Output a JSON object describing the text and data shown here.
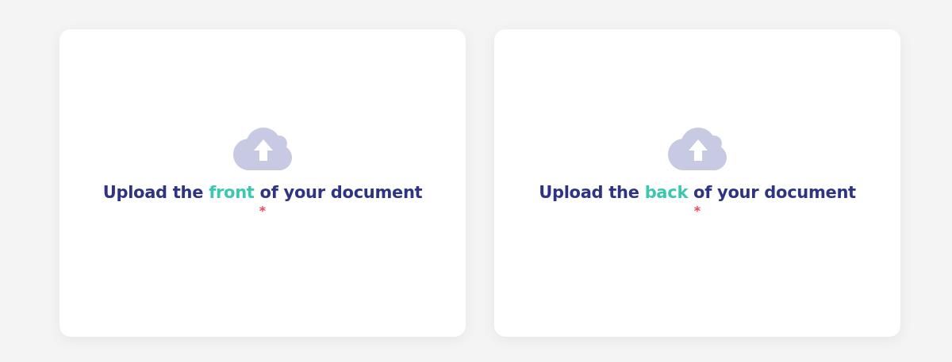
{
  "upload_cards": [
    {
      "title_start": "Upload the ",
      "highlight": "front",
      "title_end": " of your document",
      "required_mark": "*"
    },
    {
      "title_start": "Upload the ",
      "highlight": "back",
      "title_end": " of your document",
      "required_mark": "*"
    }
  ]
}
